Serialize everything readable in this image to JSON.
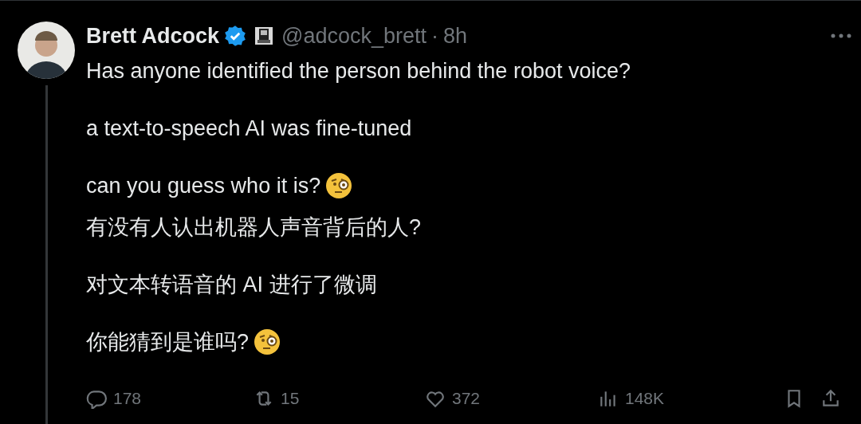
{
  "post": {
    "author": {
      "name": "Brett Adcock",
      "verified": true,
      "handle": "@adcock_brett",
      "separator": "·",
      "time": "8h"
    },
    "blocks": [
      {
        "paragraphs": [
          {
            "text": "Has anyone identified the person behind the robot voice?",
            "emoji": false
          },
          {
            "text": "a text-to-speech AI was fine-tuned",
            "emoji": false
          },
          {
            "text": "can you guess who it is?",
            "emoji": true
          }
        ]
      },
      {
        "paragraphs": [
          {
            "text": "有没有人认出机器人声音背后的人?",
            "emoji": false
          },
          {
            "text": "对文本转语音的 AI 进行了微调",
            "emoji": false
          },
          {
            "text": "你能猜到是谁吗?",
            "emoji": true
          }
        ]
      }
    ],
    "actions": [
      {
        "kind": "reply",
        "count": "178"
      },
      {
        "kind": "repost",
        "count": "15"
      },
      {
        "kind": "like",
        "count": "372"
      },
      {
        "kind": "views",
        "count": "148K"
      },
      {
        "kind": "bookmark"
      },
      {
        "kind": "share"
      }
    ]
  }
}
